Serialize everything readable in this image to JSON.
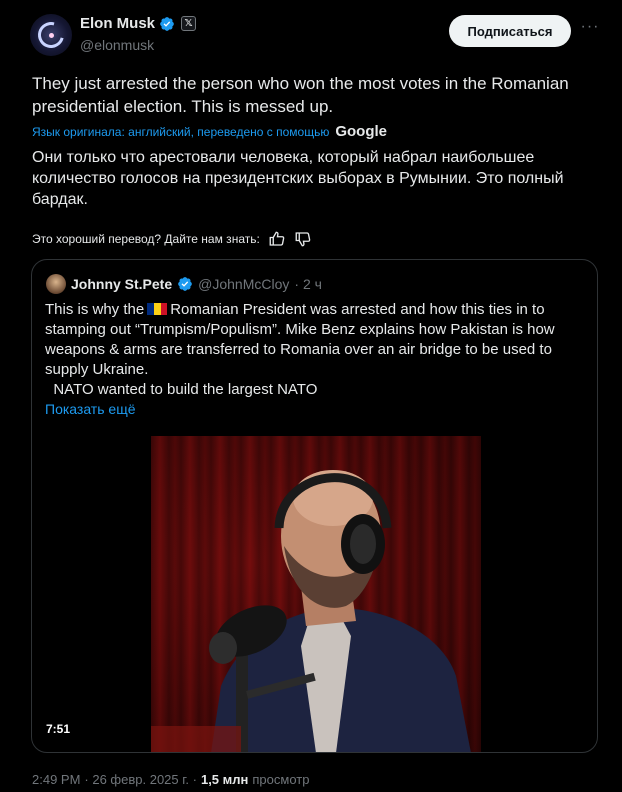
{
  "author": {
    "name": "Elon Musk",
    "handle": "@elonmusk",
    "badge": "𝕏"
  },
  "follow_label": "Подписаться",
  "more_label": "···",
  "tweet": {
    "text": "They just arrested the person who won the most votes in the Romanian presidential election. This is messed up.",
    "translation_note": "Язык оригинала: английский, переведено с помощью",
    "translation_provider": "Google",
    "translated_text": "Они только что арестовали человека, который набрал наибольшее количество голосов на президентских выборах в Румынии. Это полный бардак.",
    "feedback_prompt": "Это хороший перевод? Дайте нам знать:"
  },
  "quote": {
    "name": "Johnny St.Pete",
    "handle": "@JohnMcCloy",
    "age": "· 2 ч",
    "text_before_flag": "This is why the",
    "text_after_flag": "Romanian President was arrested and how this ties in to stamping out “Trumpism/Populism”. Mike Benz explains how Pakistan is how weapons & arms are transferred to Romania over an air bridge to be used to supply Ukraine.",
    "text_line2": "NATO wanted to build the largest NATO",
    "show_more": "Показать ещё",
    "video_duration": "7:51",
    "flag_colors": [
      "#002b7f",
      "#fcd116",
      "#ce1126"
    ]
  },
  "meta": {
    "time": "2:49 PM",
    "date": "· 26 февр. 2025 г. ·",
    "views_count": "1,5 млн",
    "views_label": "просмотр"
  },
  "colors": {
    "background": "#000000",
    "text": "#e7e9ea",
    "secondary": "#71767b",
    "accent": "#1d9bf0",
    "border": "#2f3336"
  }
}
